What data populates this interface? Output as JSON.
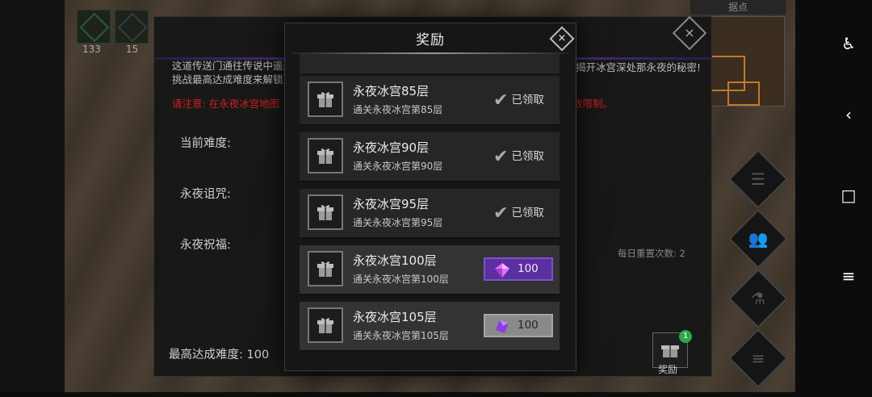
{
  "background": {
    "slot_counts": [
      "133",
      "15"
    ],
    "map_title": "据点",
    "base_dialog": {
      "desc_line1": "这道传送门通往传说中遥远",
      "desc_line2": "挑战最高达成难度来解锁更",
      "desc_right": "揭开冰宫深处那永夜的秘密!",
      "warning_left": "请注意: 在永夜冰宫地图",
      "warning_right": "数限制。",
      "label_difficulty": "当前难度:",
      "label_curse": "永夜诅咒:",
      "label_blessing": "永夜祝福:",
      "daily_resets": "每日重置次数: 2",
      "max_difficulty": "最高达成难度: 100"
    },
    "reward_button": {
      "label": "奖励",
      "badge": "1"
    }
  },
  "modal": {
    "title": "奖励",
    "close": "×",
    "rows": [
      {
        "title": "永夜冰宫85层",
        "subtitle": "通关永夜冰宫第85层",
        "status": "claimed",
        "status_label": "已领取"
      },
      {
        "title": "永夜冰宫90层",
        "subtitle": "通关永夜冰宫第90层",
        "status": "claimed",
        "status_label": "已领取"
      },
      {
        "title": "永夜冰宫95层",
        "subtitle": "通关永夜冰宫第95层",
        "status": "claimed",
        "status_label": "已领取"
      },
      {
        "title": "永夜冰宫100层",
        "subtitle": "通关永夜冰宫第100层",
        "status": "claimable",
        "reward_amount": "100"
      },
      {
        "title": "永夜冰宫105层",
        "subtitle": "通关永夜冰宫第105层",
        "status": "locked",
        "reward_amount": "100"
      }
    ]
  },
  "colors": {
    "claimable": "#5b2fa0",
    "locked": "#8a8a8a",
    "warning": "#d02020",
    "badge": "#2ea84a"
  },
  "system_nav": {
    "accessibility_icon": "accessibility-icon",
    "back_icon": "back-icon",
    "home_icon": "home-icon",
    "menu_icon": "menu-icon"
  }
}
